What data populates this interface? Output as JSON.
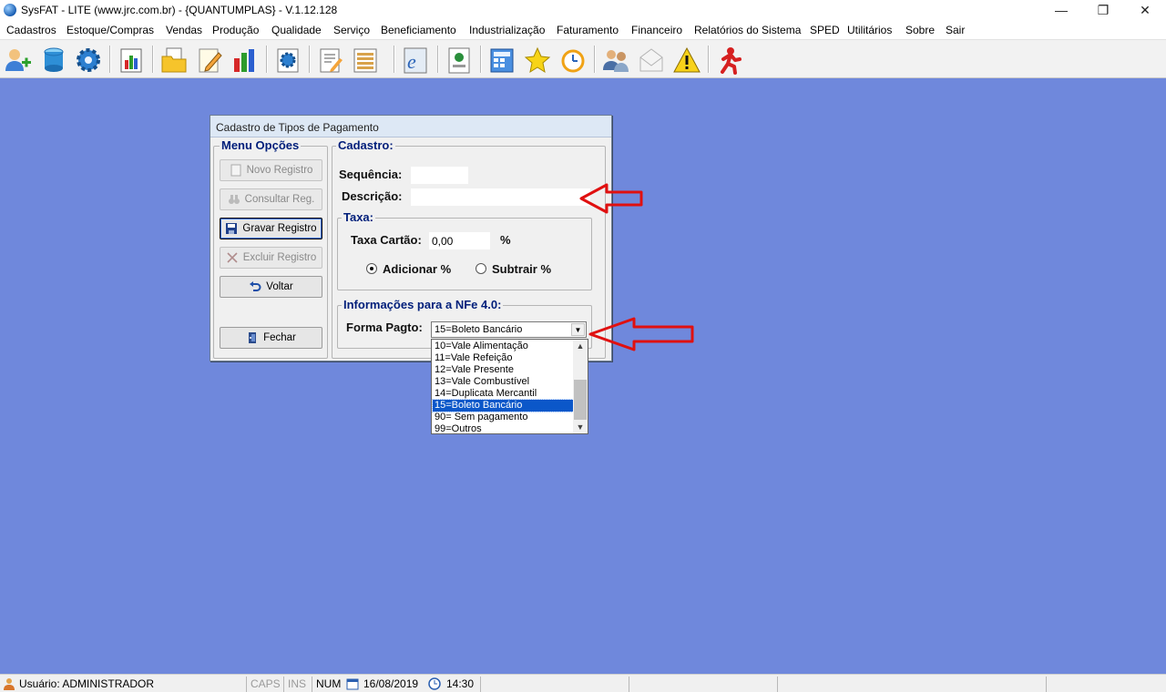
{
  "window": {
    "title": "SysFAT - LITE (www.jrc.com.br) - {QUANTUMPLAS} - V.1.12.128",
    "minimize_glyph": "—",
    "restore_glyph": "❐",
    "close_glyph": "✕"
  },
  "menu": [
    "Cadastros",
    "Estoque/Compras",
    "Vendas",
    "Produção",
    "Qualidade",
    "Serviço",
    "Beneficiamento",
    "Industrialização",
    "Faturamento",
    "Financeiro",
    "Relatórios do Sistema",
    "SPED",
    "Utilitários",
    "Sobre",
    "Sair"
  ],
  "toolbar_icons": [
    "users-add-icon",
    "database-icon",
    "gear-icon",
    "chart-book-icon",
    "folder-docs-icon",
    "pencil-doc-icon",
    "bar-chart-icon",
    "settings-doc-icon",
    "edit-doc-icon",
    "list-doc-icon",
    "nfe-icon",
    "image-doc-icon",
    "calculator-icon",
    "star-icon",
    "alarm-clock-icon",
    "people-chat-icon",
    "mail-icon",
    "warning-icon",
    "exit-runner-icon"
  ],
  "dialog": {
    "title": "Cadastro de Tipos de Pagamento",
    "menu_group": "Menu Opções",
    "cadastro_group": "Cadastro:",
    "buttons": {
      "novo": "Novo Registro",
      "consultar": "Consultar Reg.",
      "gravar": "Gravar Registro",
      "excluir": "Excluir Registro",
      "voltar": "Voltar",
      "fechar": "Fechar"
    },
    "sequencia_label": "Sequência:",
    "sequencia_value": "",
    "descricao_label": "Descrição:",
    "descricao_value": "",
    "taxa_group": "Taxa:",
    "taxa_label": "Taxa Cartão:",
    "taxa_value": "0,00",
    "taxa_unit": "%",
    "adicionar_label": "Adicionar %",
    "subtrair_label": "Subtrair %",
    "adicionar_selected": true,
    "nfe_group": "Informações para a NFe 4.0:",
    "forma_label": "Forma Pagto:",
    "forma_value": "15=Boleto Bancário",
    "forma_options": [
      "10=Vale Alimentação",
      "11=Vale Refeição",
      "12=Vale Presente",
      "13=Vale Combustível",
      "14=Duplicata Mercantil",
      "15=Boleto Bancário",
      "90= Sem pagamento",
      "99=Outros"
    ],
    "selected_option_index": 5
  },
  "annotations": {
    "arrow_color": "#e01010"
  },
  "statusbar": {
    "user": "Usuário: ADMINISTRADOR",
    "caps": "CAPS",
    "ins": "INS",
    "num": "NUM",
    "date": "16/08/2019",
    "time": "14:30"
  }
}
